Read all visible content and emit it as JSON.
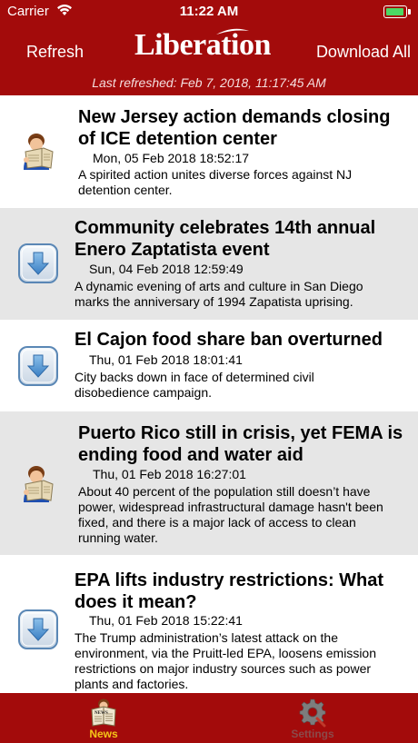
{
  "status_bar": {
    "carrier": "Carrier",
    "time": "11:22 AM"
  },
  "header": {
    "refresh_label": "Refresh",
    "logo_text": "Liberation",
    "download_label": "Download All",
    "last_refreshed": "Last refreshed: Feb 7, 2018, 11:17:45 AM"
  },
  "articles": [
    {
      "icon": "newspaper-reader-icon",
      "title_line1": "New Jersey action demands closing",
      "title_line2": "of ICE detention center",
      "date": "Mon, 05 Feb 2018 18:52:17",
      "summary_line1": "A spirited action unites diverse forces against NJ",
      "summary_line2": "detention center."
    },
    {
      "icon": "download-arrow-icon",
      "title_line1": "Community celebrates 14th annual",
      "title_line2": "Enero Zaptatista event",
      "date": "Sun, 04 Feb 2018 12:59:49",
      "summary_line1": "A dynamic evening of arts and culture in San Diego",
      "summary_line2": "marks the anniversary of 1994 Zapatista uprising."
    },
    {
      "icon": "download-arrow-icon",
      "title_line1": "El Cajon food share ban overturned",
      "date": "Thu, 01 Feb 2018 18:01:41",
      "summary_line1": "City backs down in face of determined civil",
      "summary_line2": "disobedience campaign."
    },
    {
      "icon": "newspaper-reader-icon",
      "title_line1": "Puerto Rico still in crisis, yet FEMA is",
      "title_line2": "ending food and water aid",
      "date": "Thu, 01 Feb 2018 16:27:01",
      "summary_line1": "About 40 percent of the population still doesn’t have",
      "summary_line2": "power, widespread infrastructural damage hasn't been",
      "summary_line3": "fixed, and there is a major lack of access to clean",
      "summary_line4": "running water."
    },
    {
      "icon": "download-arrow-icon",
      "title_line1": "EPA lifts industry restrictions: What",
      "title_line2": "does it mean?",
      "date": "Thu, 01 Feb 2018 15:22:41",
      "summary_line1": "The Trump administration’s latest attack on the",
      "summary_line2": "environment, via the Pruitt-led EPA, loosens emission",
      "summary_line3": "restrictions on major industry sources such as power",
      "summary_line4": "plants and factories."
    }
  ],
  "tabs": {
    "news_label": "News",
    "settings_label": "Settings"
  },
  "colors": {
    "brand_red": "#a30b0b",
    "active_tab": "#f5c518",
    "inactive_tab": "#8b4a4a",
    "alt_row": "#e6e6e6"
  }
}
